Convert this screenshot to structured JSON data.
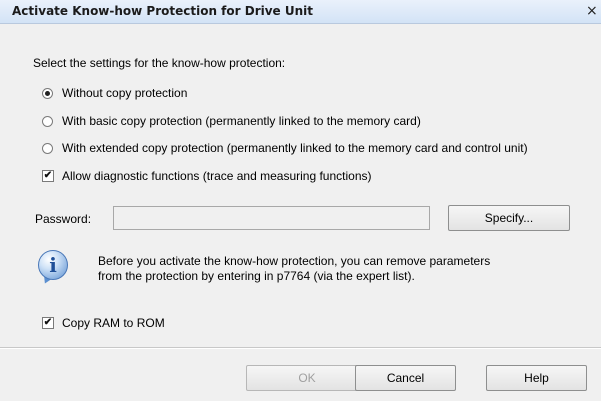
{
  "window": {
    "title": "Activate Know-how Protection for Drive Unit",
    "close_glyph": "×"
  },
  "instructions": "Select the settings for the know-how protection:",
  "protection_options": [
    {
      "label": "Without copy protection",
      "selected": true
    },
    {
      "label": "With basic copy protection (permanently linked to the memory card)",
      "selected": false
    },
    {
      "label": "With extended copy protection (permanently linked to the memory card and control unit)",
      "selected": false
    }
  ],
  "allow_diagnostics": {
    "label": "Allow diagnostic functions (trace and measuring functions)",
    "checked": true,
    "mark": "✔"
  },
  "password": {
    "label": "Password:",
    "value": "",
    "specify_label": "Specify..."
  },
  "info": {
    "line1": "Before you activate the know-how protection, you can remove parameters",
    "line2": "from the protection by entering in p7764 (via the expert list).",
    "icon_glyph": "i"
  },
  "copy_ram": {
    "label": "Copy RAM to ROM",
    "checked": true,
    "mark": "✔"
  },
  "buttons": {
    "ok": "OK",
    "cancel": "Cancel",
    "help": "Help"
  }
}
